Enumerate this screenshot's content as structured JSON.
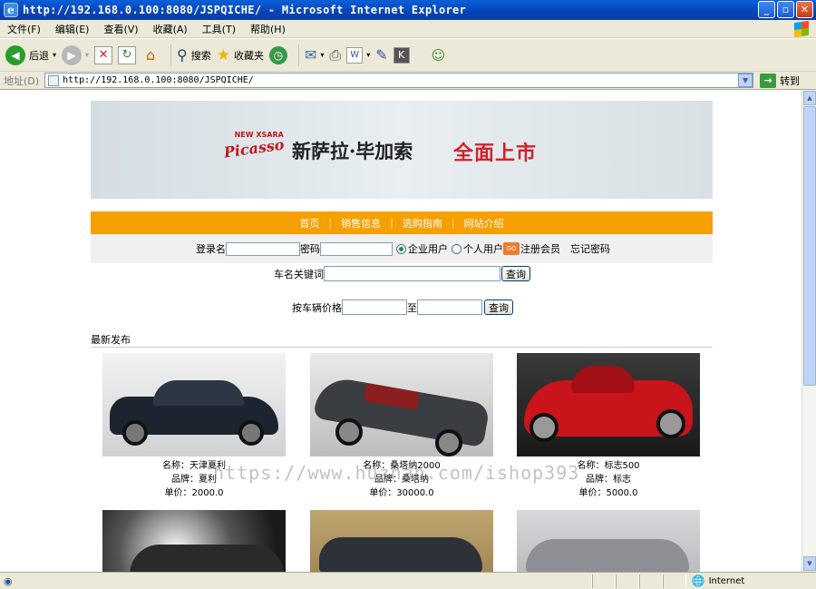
{
  "window": {
    "title": "http://192.168.0.100:8080/JSPQICHE/ - Microsoft Internet Explorer"
  },
  "menu": [
    "文件(F)",
    "编辑(E)",
    "查看(V)",
    "收藏(A)",
    "工具(T)",
    "帮助(H)"
  ],
  "toolbar": {
    "back": "后退",
    "search": "搜索",
    "favorites": "收藏夹"
  },
  "address": {
    "label": "地址(D)",
    "url": "http://192.168.0.100:8080/JSPQICHE/",
    "go": "转到"
  },
  "banner": {
    "brand_small": "NEW XSARA",
    "brand": "Picasso",
    "model": "新萨拉·毕加索",
    "slogan": "全面上市"
  },
  "nav": [
    "首页",
    "销售信息",
    "选购指南",
    "网站介绍"
  ],
  "login": {
    "username_label": "登录名",
    "password_label": "密码",
    "opt_company": "企业用户",
    "opt_personal": "个人用户",
    "go": "GO",
    "register": "注册会员",
    "forgot": "忘记密码"
  },
  "search_name": {
    "label": "车名关键词",
    "button": "查询"
  },
  "search_price": {
    "label": "按车辆价格",
    "to": "至",
    "button": "查询"
  },
  "latest_label": "最新发布",
  "cars": [
    {
      "name": "名称：天津夏利",
      "brand": "品牌：夏利",
      "price": "单价：2000.0",
      "color": "#1c2430"
    },
    {
      "name": "名称：桑塔纳2000",
      "brand": "品牌：桑塔纳",
      "price": "单价：30000.0",
      "color": "#3a3d42"
    },
    {
      "name": "名称：标志500",
      "brand": "品牌：标志",
      "price": "单价：5000.0",
      "color": "#c8141a"
    },
    {
      "color": "#2a2a2a"
    },
    {
      "color": "#2d3138"
    },
    {
      "color": "#8d8f94"
    }
  ],
  "watermark": "https://www.huzhan.com/ishop393",
  "status": {
    "zone": "Internet"
  }
}
